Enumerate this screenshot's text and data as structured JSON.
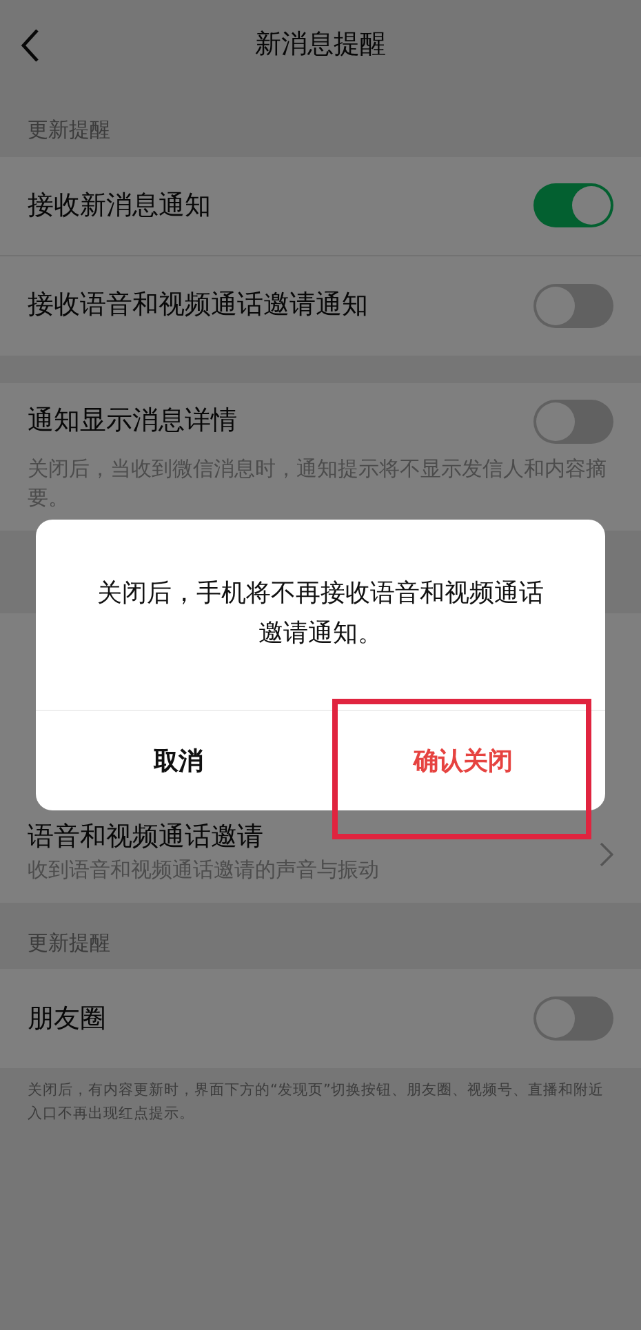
{
  "nav": {
    "title": "新消息提醒"
  },
  "sections": [
    {
      "header": "更新提醒",
      "items": [
        {
          "label": "接收新消息通知",
          "kind": "switch",
          "on": true
        },
        {
          "label": "接收语音和视频通话邀请通知",
          "kind": "switch",
          "on": false
        }
      ]
    },
    {
      "items": [
        {
          "label": "通知显示消息详情",
          "kind": "switch",
          "on": false,
          "description": "关闭后，当收到微信消息时，通知提示将不显示发信人和内容摘要。"
        }
      ]
    },
    {
      "items": [
        {
          "label": "语音和视频通话邀请",
          "kind": "link",
          "description": "收到语音和视频通话邀请的声音与振动"
        }
      ]
    },
    {
      "header": "更新提醒",
      "items": [
        {
          "label": "朋友圈",
          "kind": "switch",
          "on": false
        }
      ],
      "note": "关闭后，有内容更新时，界面下方的“发现页”切换按钮、朋友圈、视频号、直播和附近入口不再出现红点提示。"
    }
  ],
  "dialog": {
    "message": "关闭后，手机将不再接收语音和视频通话邀请通知。",
    "buttons": [
      {
        "label": "取消",
        "kind": "cancel",
        "highlighted": false
      },
      {
        "label": "确认关闭",
        "kind": "confirm",
        "highlighted": true
      }
    ]
  }
}
